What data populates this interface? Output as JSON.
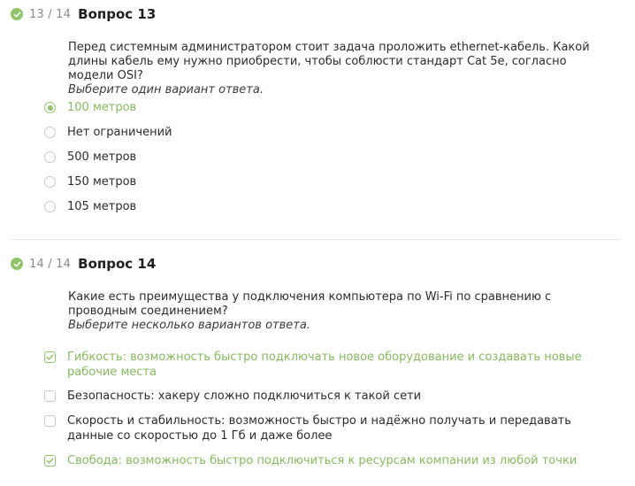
{
  "questions": [
    {
      "counter": "13 / 14",
      "title": "Вопрос 13",
      "text": "Перед системным администратором стоит задача проложить ethernet-кабель. Какой длины кабель ему нужно приобрести, чтобы соблюсти стандарт Cat 5e, согласно модели OSI?",
      "hint": "Выберите один вариант ответа.",
      "options": [
        {
          "label": "100 метров",
          "selected": true
        },
        {
          "label": "Нет ограничений",
          "selected": false
        },
        {
          "label": "500 метров",
          "selected": false
        },
        {
          "label": "150 метров",
          "selected": false
        },
        {
          "label": "105 метров",
          "selected": false
        }
      ]
    },
    {
      "counter": "14 / 14",
      "title": "Вопрос 14",
      "text": "Какие есть преимущества у подключения компьютера по Wi-Fi по сравнению с проводным соединением?",
      "hint": "Выберите несколько вариантов ответа.",
      "options": [
        {
          "label": "Гибкость: возможность быстро подключать новое оборудование и создавать новые рабочие места",
          "selected": true
        },
        {
          "label": "Безопасность: хакеру сложно подключиться к такой сети",
          "selected": false
        },
        {
          "label": "Скорость и стабильность: возможность быстро и надёжно получать и передавать данные со скоростью до 1 Гб и даже более",
          "selected": false
        },
        {
          "label": "Свобода: возможность быстро подключиться к ресурсам компании из любой точки",
          "selected": true
        }
      ]
    }
  ],
  "colors": {
    "accent": "#8fc46a",
    "selected_text": "#86bb5d",
    "divider": "#e6e6e6"
  },
  "icons": {
    "done": "check-circle-icon",
    "checkmark": "checkmark-icon"
  }
}
